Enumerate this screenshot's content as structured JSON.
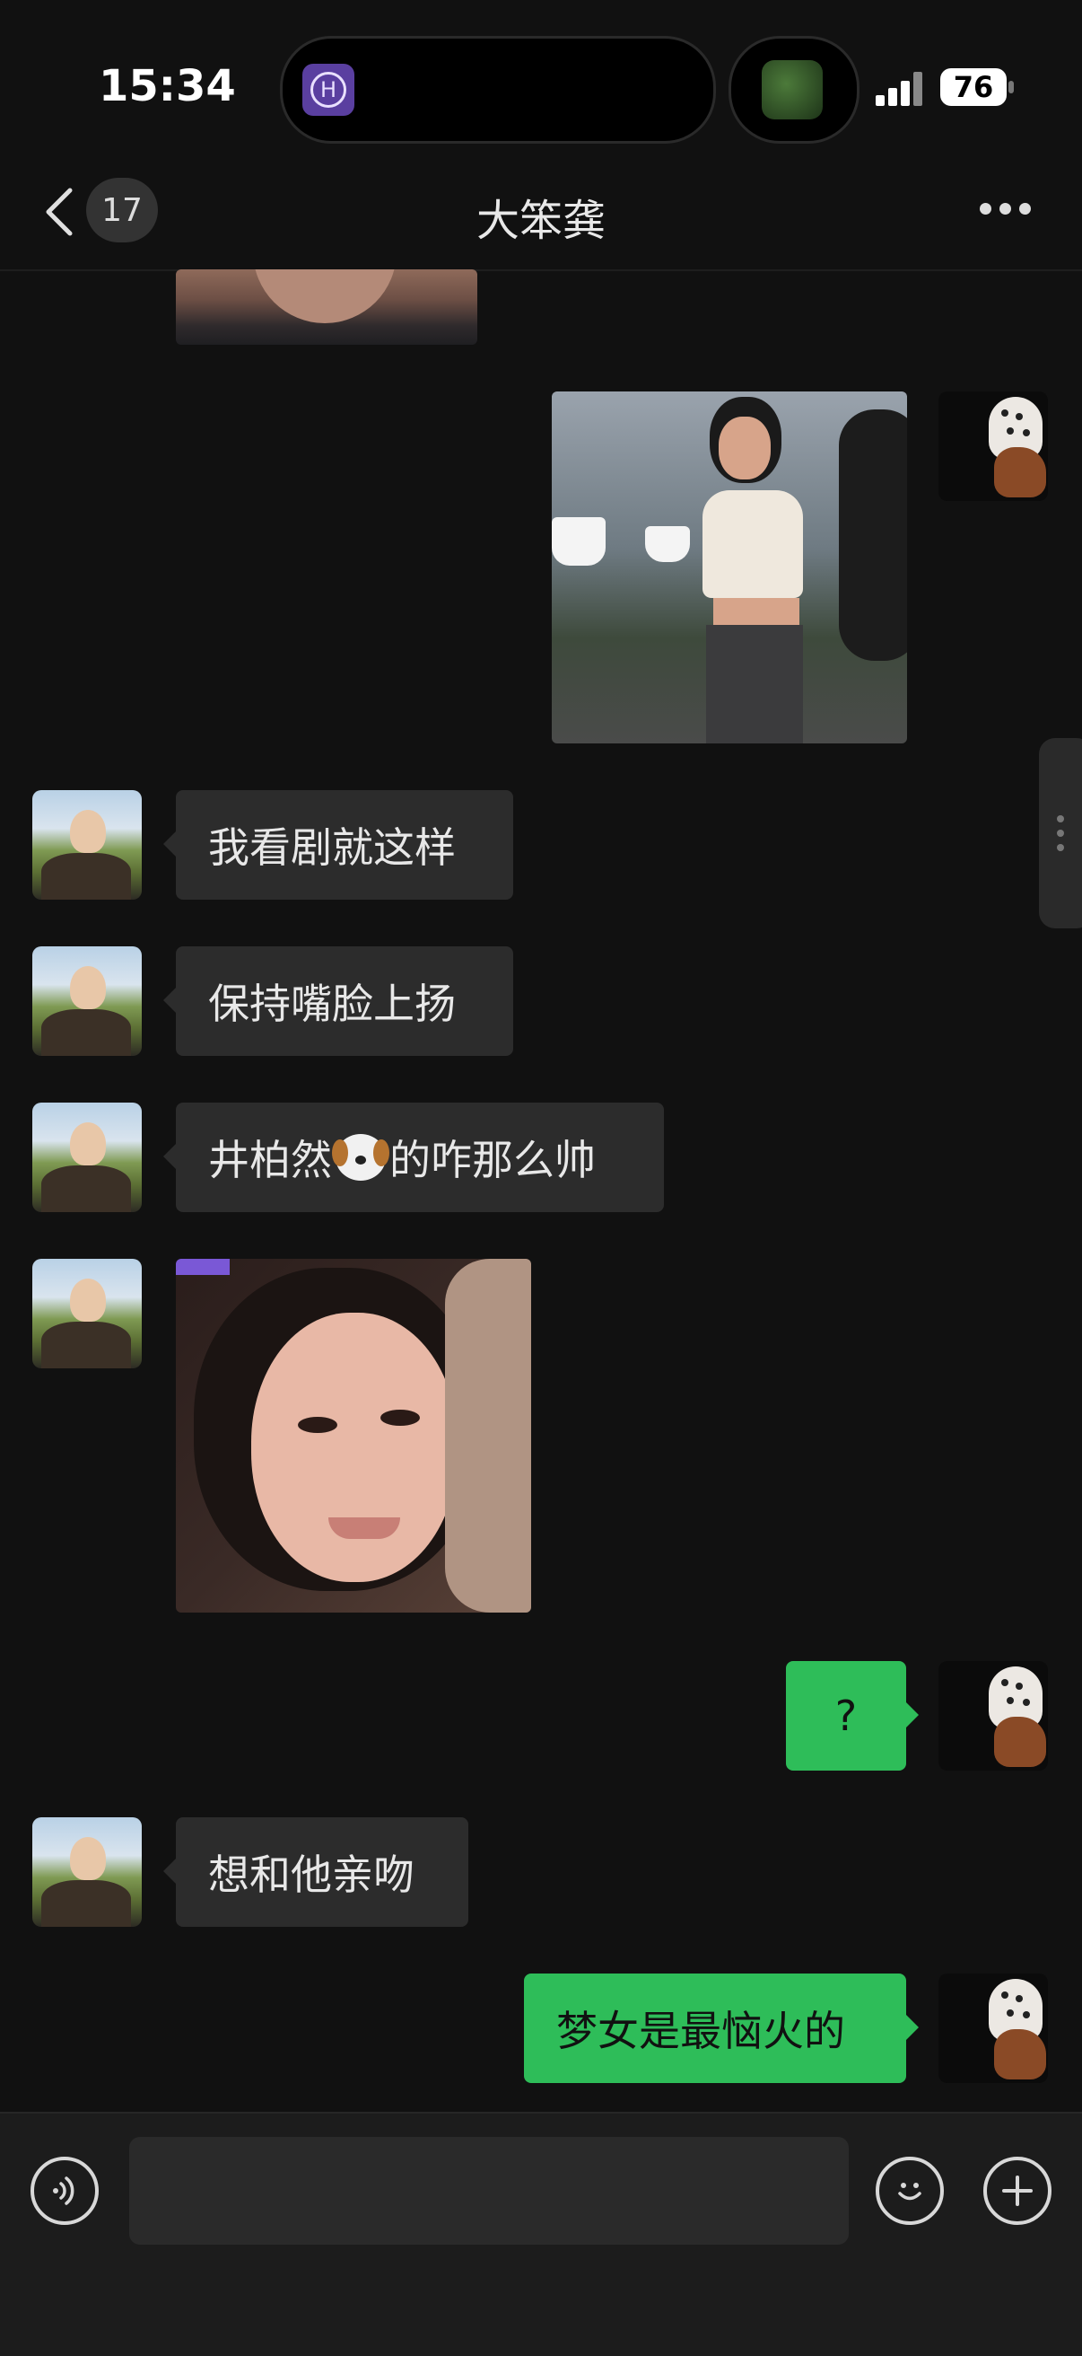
{
  "status_bar": {
    "time": "15:34",
    "island_app_letter": "H",
    "battery": "76"
  },
  "nav": {
    "unread_count": "17",
    "title": "大笨龚"
  },
  "messages": [
    {
      "type": "image",
      "side": "left",
      "description": "cropped face photo"
    },
    {
      "type": "image",
      "side": "right",
      "description": "girl holding cup outdoors"
    },
    {
      "type": "text",
      "side": "left",
      "text": "我看剧就这样"
    },
    {
      "type": "text",
      "side": "left",
      "text": "保持嘴脸上扬"
    },
    {
      "type": "text",
      "side": "left",
      "text_before": "井柏然",
      "emoji": "dog-face-emoji",
      "text_after": "的咋那么帅"
    },
    {
      "type": "image",
      "side": "left",
      "description": "smiling girl selfie"
    },
    {
      "type": "text",
      "side": "right",
      "text": "?"
    },
    {
      "type": "text",
      "side": "left",
      "text": "想和他亲吻"
    },
    {
      "type": "text",
      "side": "right",
      "text": "梦女是最恼火的"
    }
  ],
  "input_bar": {
    "placeholder": ""
  },
  "colors": {
    "background": "#111111",
    "bubble_received": "#2c2c2c",
    "bubble_sent": "#2ebd59"
  }
}
